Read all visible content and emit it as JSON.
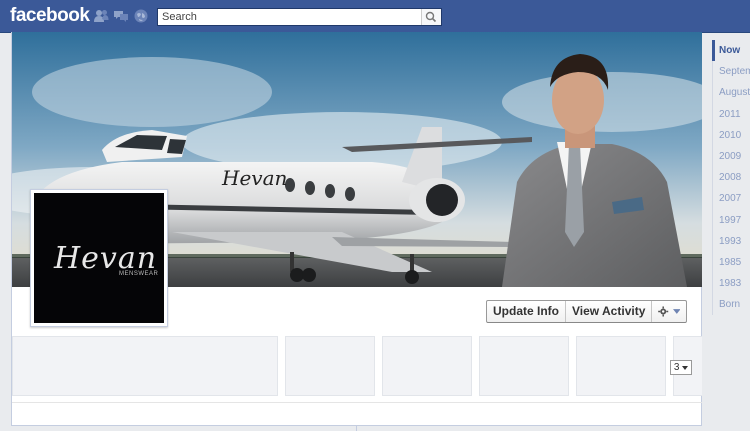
{
  "topbar": {
    "logo": "facebook",
    "search_placeholder": "Search",
    "jewels": [
      "friend-requests-icon",
      "messages-icon",
      "notifications-icon"
    ]
  },
  "profile": {
    "brand_name": "Hevan",
    "brand_tagline": "MENSWEAR"
  },
  "actions": {
    "update_info": "Update Info",
    "view_activity": "View Activity",
    "settings_icon": "gear-icon"
  },
  "apps": {
    "more_count": "3"
  },
  "timeline": {
    "items": [
      "Now",
      "September",
      "August",
      "2011",
      "2010",
      "2009",
      "2008",
      "2007",
      "1997",
      "1993",
      "1985",
      "1983",
      "Born"
    ]
  },
  "colors": {
    "brand_blue": "#3b5998",
    "timeline_text": "#8b9dc3"
  }
}
